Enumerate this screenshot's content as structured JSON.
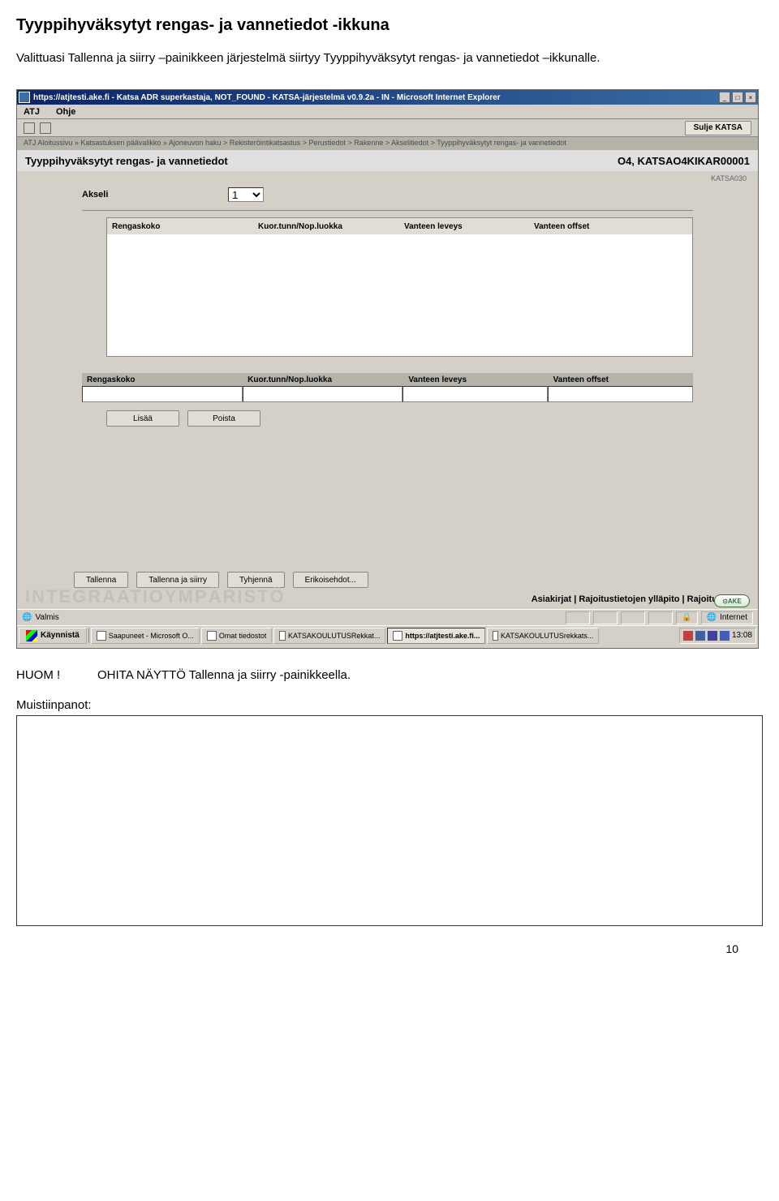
{
  "doc": {
    "title": "Tyyppihyväksytyt rengas- ja vannetiedot -ikkuna",
    "paragraph": "Valittuasi Tallenna ja siirry –painikkeen järjestelmä siirtyy Tyyppihyväksytyt rengas- ja vannetiedot –ikkunalle.",
    "huom_label": "HUOM !",
    "huom_text": "OHITA NÄYTTÖ Tallenna ja siirry -painikkeella.",
    "notes_label": "Muistiinpanot:",
    "page_number": "10"
  },
  "ie": {
    "title": "https://atjtesti.ake.fi - Katsa ADR superkastaja, NOT_FOUND - KATSA-järjestelmä v0.9.2a - IN - Microsoft Internet Explorer",
    "menu": {
      "atj": "ATJ",
      "ohje": "Ohje"
    },
    "close_katsa": "Sulje KATSA",
    "breadcrumb": "ATJ Aloitussivu » Katsastuksen päävalikko » Ajoneuvon haku > Rekisteröintikatsastus > Perustiedot > Rakenne > Akselitiedot > Tyyppihyväksytyt rengas- ja vannetiedot",
    "page_title": "Tyyppihyväksytyt rengas- ja vannetiedot",
    "page_code": "O4, KATSAO4KIKAR00001",
    "right_code": "KATSA030",
    "field": {
      "akseli_label": "Akseli",
      "akseli_value": "1"
    },
    "table_headers": {
      "rengaskoko": "Rengaskoko",
      "kuor": "Kuor.tunn/Nop.luokka",
      "leveys": "Vanteen leveys",
      "offset": "Vanteen offset"
    },
    "input_labels": {
      "rengaskoko": "Rengaskoko",
      "kuor": "Kuor.tunn/Nop.luokka",
      "leveys": "Vanteen leveys",
      "offset": "Vanteen offset"
    },
    "buttons": {
      "lisaa": "Lisää",
      "poista": "Poista",
      "tallenna": "Tallenna",
      "tallenna_siirry": "Tallenna ja siirry",
      "tyhjenna": "Tyhjennä",
      "erikoisehdot": "Erikoisehdot..."
    },
    "bottom_links": "Asiakirjat  |  Rajoitustietojen ylläpito  |  Rajoitustiedot",
    "watermark": "INTEGRAATIOYMPÄRISTÖ",
    "ake_logo": "AKE",
    "status": {
      "valmis": "Valmis",
      "internet": "Internet"
    }
  },
  "taskbar": {
    "start": "Käynnistä",
    "items": [
      "Saapuneet - Microsoft O...",
      "Omat tiedostot",
      "KATSAKOULUTUSRekkat...",
      "https://atjtesti.ake.fi...",
      "KATSAKOULUTUSrekkats..."
    ],
    "clock": "13:08"
  }
}
